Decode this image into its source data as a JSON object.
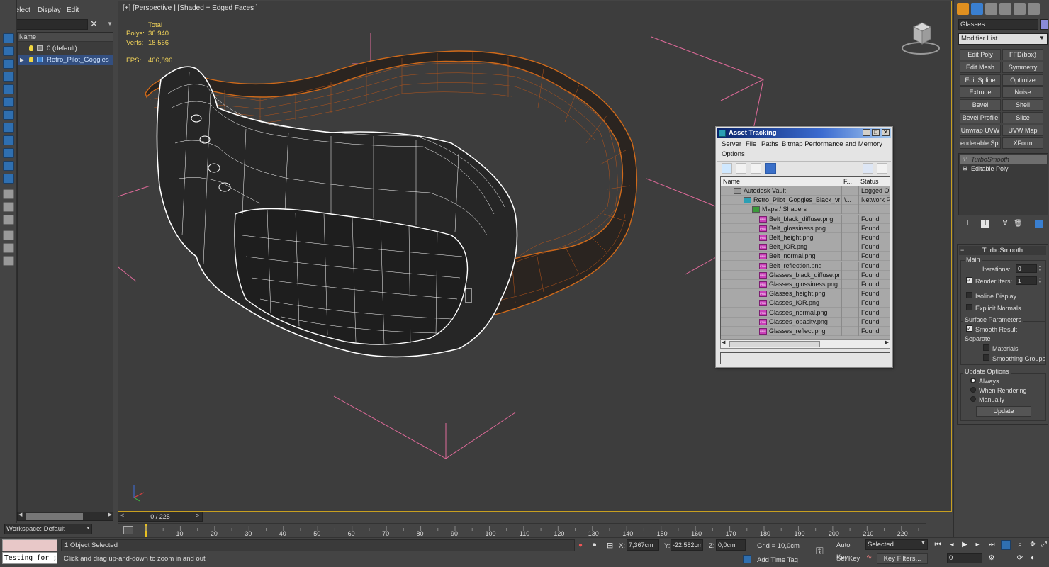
{
  "scene_explorer": {
    "menu": [
      "Select",
      "Display",
      "Edit"
    ],
    "search_value": "",
    "header": "Name",
    "items": [
      {
        "label": "0 (default)"
      },
      {
        "label": "Retro_Pilot_Goggles"
      }
    ],
    "workspace": "Workspace: Default"
  },
  "viewport": {
    "label": "[+] [Perspective ] [Shaded + Edged Faces ]",
    "stats": {
      "total_label": "Total",
      "polys_label": "Polys:",
      "polys_value": "36 940",
      "verts_label": "Verts:",
      "verts_value": "18 566",
      "fps_label": "FPS:",
      "fps_value": "406,896"
    }
  },
  "time_slider": {
    "value": "0 / 225"
  },
  "trackbar": {
    "ticks": [
      "10",
      "20",
      "30",
      "40",
      "50",
      "60",
      "70",
      "80",
      "90",
      "100",
      "110",
      "120",
      "130",
      "140",
      "150",
      "160",
      "170",
      "180",
      "190",
      "200",
      "210",
      "220"
    ]
  },
  "status_bar": {
    "maxscript_value": "Testing for ;",
    "selection": "1 Object Selected",
    "prompt": "Click and drag up-and-down to zoom in and out",
    "x_label": "X:",
    "x_value": "7,367cm",
    "y_label": "Y:",
    "y_value": "-22,582cm",
    "z_label": "Z:",
    "z_value": "0,0cm",
    "grid": "Grid = 10,0cm",
    "add_time_tag": "Add Time Tag",
    "auto_key": "Auto Key",
    "set_key": "Set Key",
    "key_mode": "Selected",
    "key_filters": "Key Filters...",
    "frame": "0"
  },
  "command_panel": {
    "object_name": "Glasses",
    "modifier_list": "Modifier List",
    "modifier_buttons": [
      [
        "Edit Poly",
        "FFD(box)"
      ],
      [
        "Edit Mesh",
        "Symmetry"
      ],
      [
        "Edit Spline",
        "Optimize"
      ],
      [
        "Extrude",
        "Noise"
      ],
      [
        "Bevel",
        "Shell"
      ],
      [
        "Bevel Profile",
        "Slice"
      ],
      [
        "Unwrap UVW",
        "UVW Map"
      ],
      [
        "enderable Splin",
        "XForm"
      ]
    ],
    "stack": [
      "TurboSmooth",
      "Editable Poly"
    ],
    "rollout": {
      "title": "TurboSmooth",
      "main_label": "Main",
      "iterations_label": "Iterations:",
      "iterations_value": "0",
      "render_iters_label": "Render Iters:",
      "render_iters_value": "1",
      "isoline_label": "Isoline Display",
      "explicit_normals_label": "Explicit Normals",
      "surface_label": "Surface Parameters",
      "smooth_result_label": "Smooth Result",
      "separate_label": "Separate",
      "materials_label": "Materials",
      "smoothing_groups_label": "Smoothing Groups",
      "update_options_label": "Update Options",
      "always_label": "Always",
      "when_rendering_label": "When Rendering",
      "manually_label": "Manually",
      "update_button": "Update"
    }
  },
  "asset_tracking": {
    "title": "Asset Tracking",
    "menu": [
      "Server",
      "File",
      "Paths",
      "Bitmap Performance and Memory",
      "Options"
    ],
    "columns": [
      "Name",
      "F...",
      "Status"
    ],
    "rows": [
      {
        "name": "Autodesk Vault",
        "f": "",
        "status": "Logged Out"
      },
      {
        "name": "Retro_Pilot_Goggles_Black_vr...",
        "f": "\\...",
        "status": "Network Pa"
      },
      {
        "name": "Maps / Shaders",
        "f": "",
        "status": ""
      },
      {
        "name": "Belt_black_diffuse.png",
        "f": "",
        "status": "Found"
      },
      {
        "name": "Belt_glossiness.png",
        "f": "",
        "status": "Found"
      },
      {
        "name": "Belt_height.png",
        "f": "",
        "status": "Found"
      },
      {
        "name": "Belt_IOR.png",
        "f": "",
        "status": "Found"
      },
      {
        "name": "Belt_normal.png",
        "f": "",
        "status": "Found"
      },
      {
        "name": "Belt_reflection.png",
        "f": "",
        "status": "Found"
      },
      {
        "name": "Glasses_black_diffuse.png",
        "f": "",
        "status": "Found"
      },
      {
        "name": "Glasses_glossiness.png",
        "f": "",
        "status": "Found"
      },
      {
        "name": "Glasses_height.png",
        "f": "",
        "status": "Found"
      },
      {
        "name": "Glasses_IOR.png",
        "f": "",
        "status": "Found"
      },
      {
        "name": "Glasses_normal.png",
        "f": "",
        "status": "Found"
      },
      {
        "name": "Glasses_opasity.png",
        "f": "",
        "status": "Found"
      },
      {
        "name": "Glasses_reflect.png",
        "f": "",
        "status": "Found"
      }
    ]
  },
  "colors": {
    "viewport_bg": "#3d3d3d",
    "viewport_border": "#c8a020",
    "selection_blue": "#334f80",
    "wire_orange": "#d06a1a",
    "bbox_pink": "#e06a9a",
    "stats_yellow": "#f2d45a"
  }
}
